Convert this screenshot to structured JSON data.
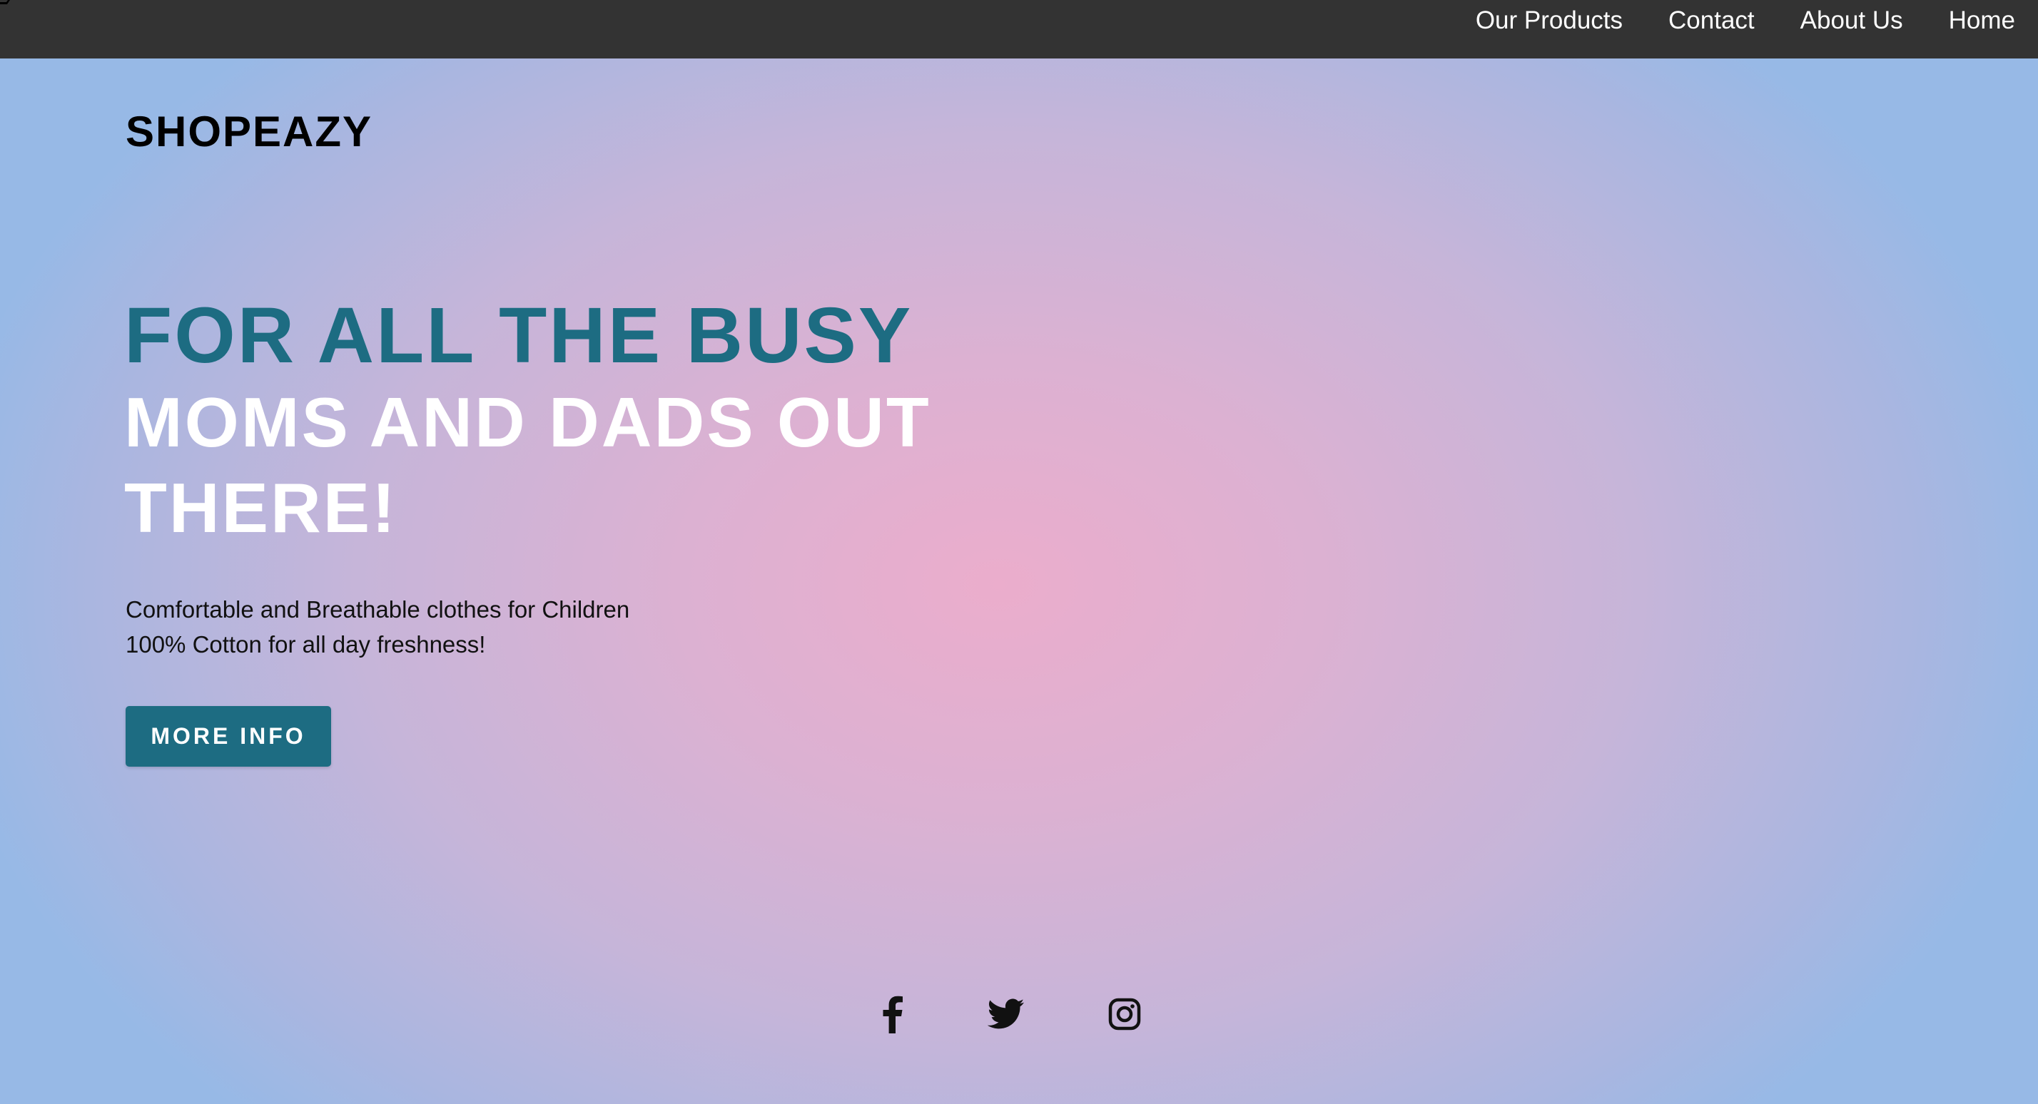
{
  "nav": {
    "items": [
      "Our Products",
      "Contact",
      "About Us",
      "Home"
    ]
  },
  "brand": {
    "name": "SHOPEAZY"
  },
  "hero": {
    "title_line1": "FOR ALL THE BUSY",
    "title_line2": "MOMS AND DADS OUT",
    "title_line3": "THERE!",
    "tagline_line1": "Comfortable and Breathable clothes for Children",
    "tagline_line2": "100% Cotton for all day freshness!",
    "button_label": "MORE INFO"
  },
  "social": {
    "icons": [
      "facebook-icon",
      "twitter-icon",
      "instagram-icon"
    ]
  },
  "colors": {
    "navbar_bg": "#333333",
    "accent": "#1d6c82",
    "gradient_center": "#ebadcc",
    "gradient_edge": "#97b9e6"
  }
}
